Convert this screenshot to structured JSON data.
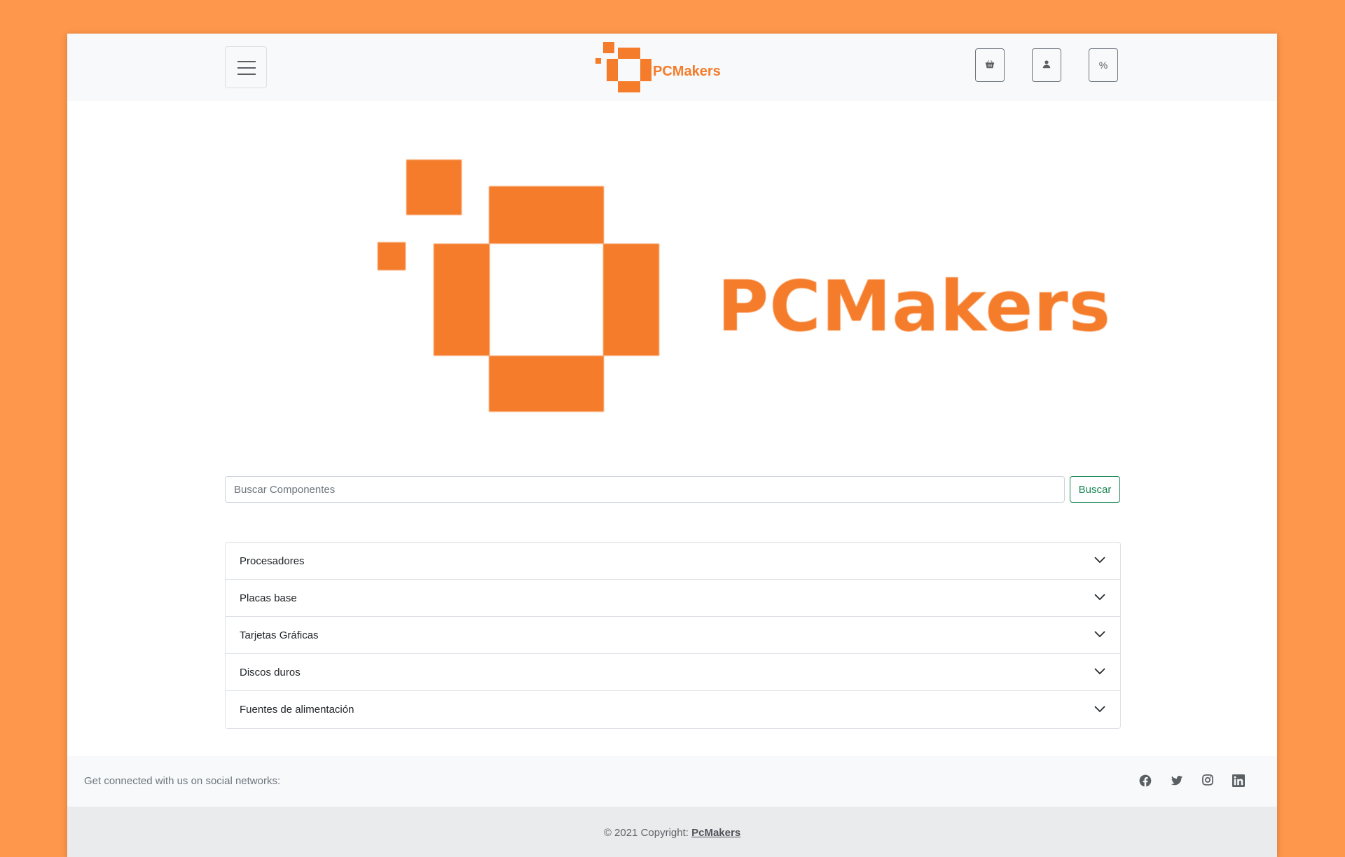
{
  "navbar": {
    "menu_icon": "hamburger-menu-icon",
    "brand_name": "PCMakers",
    "icons": [
      "basket-icon",
      "user-icon",
      "percent-icon"
    ],
    "percent_glyph": "%"
  },
  "hero": {
    "brand_name": "PCMakers"
  },
  "search": {
    "placeholder": "Buscar Componentes",
    "button_label": "Buscar"
  },
  "categories": [
    {
      "label": "Procesadores"
    },
    {
      "label": "Placas base"
    },
    {
      "label": "Tarjetas Gráficas"
    },
    {
      "label": "Discos duros"
    },
    {
      "label": "Fuentes de alimentación"
    }
  ],
  "footer": {
    "social_text": "Get connected with us on social networks:",
    "social_icons": [
      "facebook-icon",
      "twitter-icon",
      "instagram-icon",
      "linkedin-icon"
    ],
    "copyright_prefix": "© 2021 Copyright:",
    "copyright_link": "PcMakers"
  },
  "colors": {
    "background": "#fe974b",
    "brand_orange": "#f47c2a",
    "search_button": "#198754"
  }
}
